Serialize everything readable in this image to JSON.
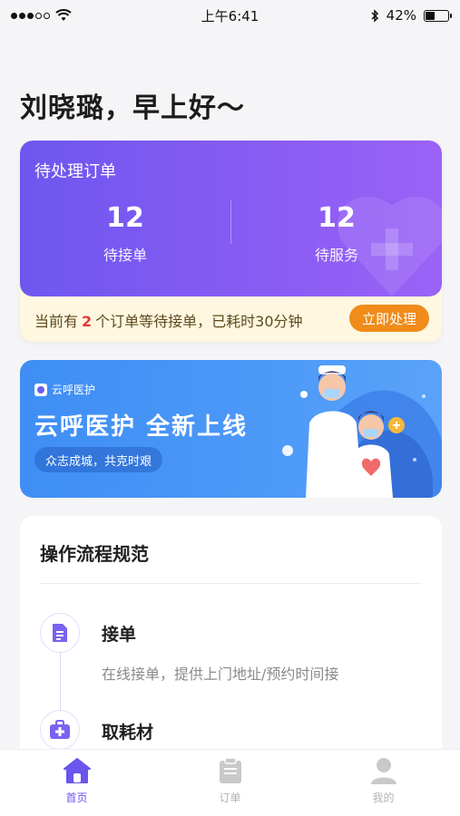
{
  "status_bar": {
    "time": "上午6:41",
    "battery": "42%",
    "battery_level": 0.42
  },
  "greeting": "刘晓璐，早上好～",
  "orders": {
    "title": "待处理订单",
    "stats": [
      {
        "value": "12",
        "label": "待接单"
      },
      {
        "value": "12",
        "label": "待服务"
      }
    ],
    "notice_prefix": "当前有",
    "notice_count": "2",
    "notice_suffix": "个订单等待接单，已耗时30分钟",
    "action_label": "立即处理"
  },
  "banner": {
    "logo_text": "云呼医护",
    "headline": "云呼医护  全新上线",
    "slogan": "众志成城，共克时艰"
  },
  "process": {
    "title": "操作流程规范",
    "steps": [
      {
        "title": "接单",
        "desc": "在线接单，提供上门地址/预约时间接",
        "icon": "document-icon"
      },
      {
        "title": "取耗材",
        "desc": "",
        "icon": "medical-kit-icon"
      }
    ]
  },
  "tabbar": {
    "items": [
      {
        "label": "首页",
        "icon": "home-icon",
        "active": true
      },
      {
        "label": "订单",
        "icon": "clipboard-icon",
        "active": false
      },
      {
        "label": "我的",
        "icon": "user-icon",
        "active": false
      }
    ]
  },
  "colors": {
    "accent": "#6a55ee",
    "banner": "#4b98f7",
    "warning_button": "#f08c1a",
    "highlight": "#e53935"
  }
}
